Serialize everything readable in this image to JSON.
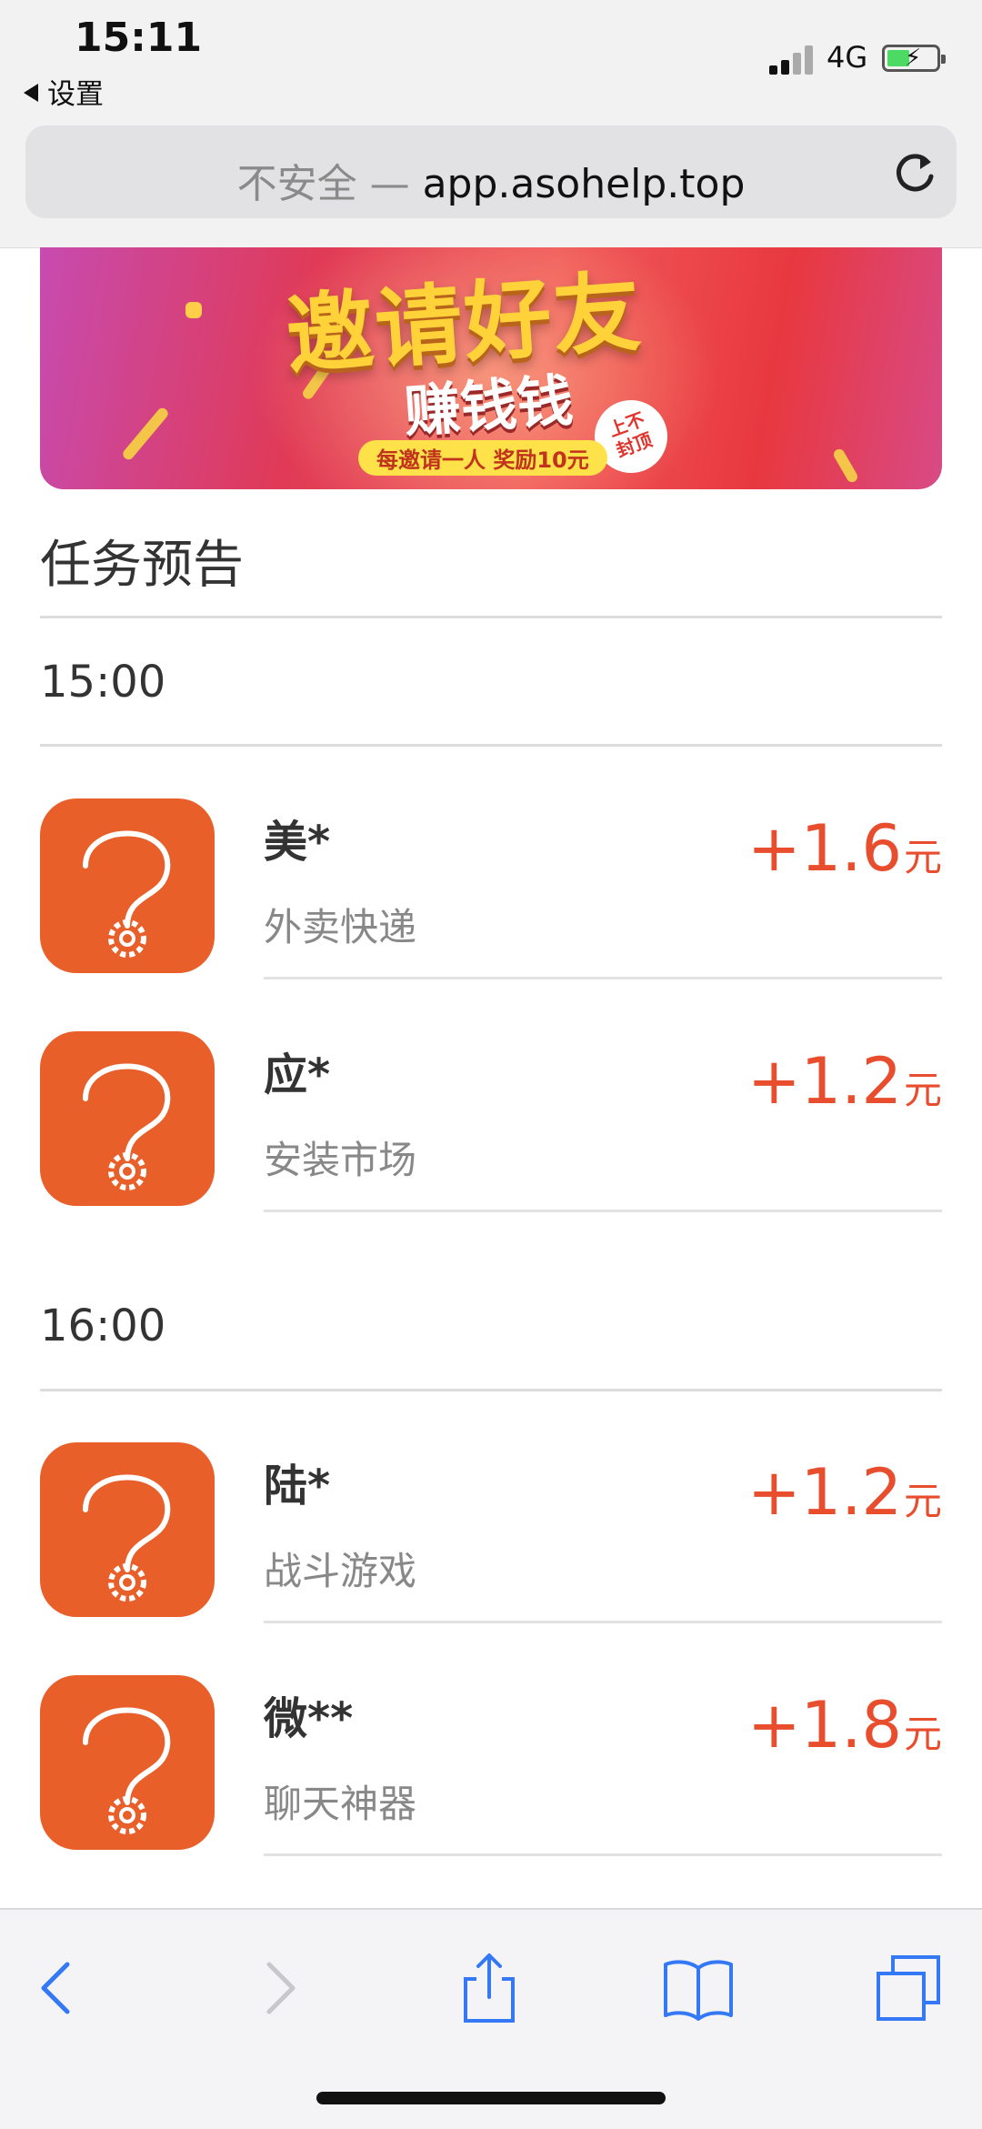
{
  "status": {
    "time": "15:11",
    "back_label": "设置",
    "network": "4G"
  },
  "browser": {
    "url_insecure": "不安全 —",
    "url_host": "app.asohelp.top"
  },
  "banner": {
    "headline": "邀请好友",
    "subline": "赚钱钱",
    "pill": "每邀请一人 奖励10元",
    "seal_line1": "上不",
    "seal_line2": "封顶"
  },
  "section_title": "任务预告",
  "accent_color": "#e84d2e",
  "icon_color": "#e85f2a",
  "groups": [
    {
      "time": "15:00",
      "items": [
        {
          "name": "美*",
          "desc": "外卖快递",
          "amount": "+1.6",
          "unit": "元"
        },
        {
          "name": "应*",
          "desc": "安装市场",
          "amount": "+1.2",
          "unit": "元"
        }
      ]
    },
    {
      "time": "16:00",
      "items": [
        {
          "name": "陆*",
          "desc": "战斗游戏",
          "amount": "+1.2",
          "unit": "元"
        },
        {
          "name": "微**",
          "desc": "聊天神器",
          "amount": "+1.8",
          "unit": "元"
        }
      ]
    }
  ],
  "toolbar": {
    "icons": [
      "back-icon",
      "forward-icon",
      "share-icon",
      "bookmarks-icon",
      "tabs-icon"
    ]
  }
}
